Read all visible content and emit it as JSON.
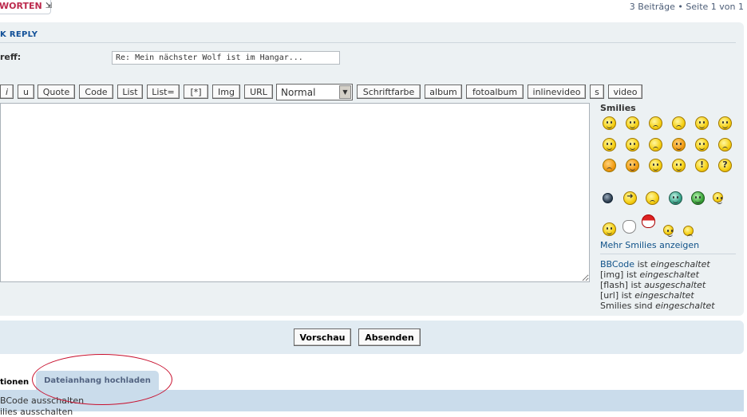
{
  "topbar": {
    "reply_button_label": "WORTEN",
    "reply_icon": "reply-arrow-icon",
    "pagination": "3 Beiträge • Seite 1 von 1"
  },
  "quick_reply": {
    "title": "K REPLY",
    "subject_label": "reff:",
    "subject_value": "Re: Mein nächster Wolf ist im Hangar..."
  },
  "toolbar": {
    "buttons": [
      "i",
      "u",
      "Quote",
      "Code",
      "List",
      "List=",
      "[*]",
      "Img",
      "URL",
      "Schriftfarbe",
      "album",
      "fotoalbum",
      "inlinevideo",
      "s",
      "video"
    ],
    "font_size_selected": "Normal"
  },
  "smilies": {
    "title": "Smilies",
    "more_link": "Mehr Smilies anzeigen"
  },
  "status": {
    "bbcode_link": "BBCode",
    "bbcode_rest": "ist",
    "bbcode_state": "eingeschaltet",
    "img_label": "[img] ist",
    "img_state": "eingeschaltet",
    "flash_label": "[flash] ist",
    "flash_state": "ausgeschaltet",
    "url_label": "[url] ist",
    "url_state": "eingeschaltet",
    "smilies_label": "Smilies sind",
    "smilies_state": "eingeschaltet"
  },
  "actions": {
    "preview_label": "Vorschau",
    "submit_label": "Absenden"
  },
  "tabs": {
    "options_label": "tionen",
    "attach_label": "Dateianhang hochladen"
  },
  "options": {
    "disable_bbcode": "BCode ausschalten",
    "disable_smilies": "ilies ausschalten"
  },
  "colors": {
    "accent_red": "#bc2a4d",
    "link_blue": "#105289",
    "panel_bg": "#ecf1f3",
    "tab_bg": "#cadceb",
    "highlight_ellipse": "#c8102e"
  }
}
